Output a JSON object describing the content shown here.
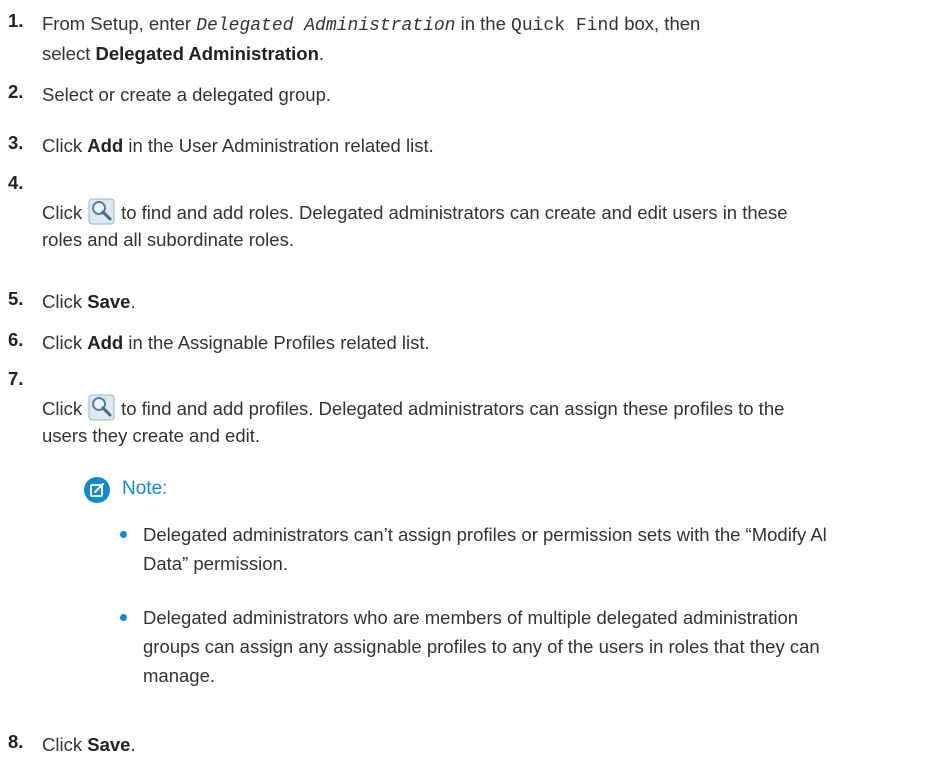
{
  "steps": [
    {
      "number": "1.",
      "prefix": "From Setup, enter ",
      "code_italic": "Delegated Administration",
      "middle": " in the ",
      "code": "Quick Find",
      "mid2": " box, then",
      "line2_prefix": "select ",
      "bold": "Delegated Administration",
      "suffix": "."
    },
    {
      "number": "2.",
      "text": "Select or create a delegated group."
    },
    {
      "number": "3.",
      "prefix": "Click ",
      "bold": "Add",
      "suffix": " in the User Administration related list."
    },
    {
      "number": "4.",
      "prefix": "Click",
      "suffix_line1": "to find and add roles. Delegated administrators can create and edit users in these",
      "line2": "roles and all subordinate roles.",
      "icon": "lookup-magnifier-icon"
    },
    {
      "number": "5.",
      "prefix": "Click ",
      "bold": "Save",
      "suffix": "."
    },
    {
      "number": "6.",
      "prefix": "Click ",
      "bold": "Add",
      "suffix": " in the Assignable Profiles related list."
    },
    {
      "number": "7.",
      "prefix": "Click",
      "suffix_line1": "to find and add profiles. Delegated administrators can assign these profiles to the",
      "line2": "users they create and edit.",
      "icon": "lookup-magnifier-icon"
    },
    {
      "number": "8.",
      "prefix": "Click ",
      "bold": "Save",
      "suffix": "."
    }
  ],
  "note": {
    "label": "Note:",
    "icon": "edit-note-icon",
    "accent": "#1589c8",
    "bullets": [
      {
        "line1": "Delegated administrators can’t assign profiles or permission sets with the “Modify Al",
        "line2": "Data” permission."
      },
      {
        "line1": "Delegated administrators who are members of multiple delegated administration",
        "line2": "groups can assign any assignable profiles to any of the users in roles that they can",
        "line3": "manage."
      }
    ]
  }
}
